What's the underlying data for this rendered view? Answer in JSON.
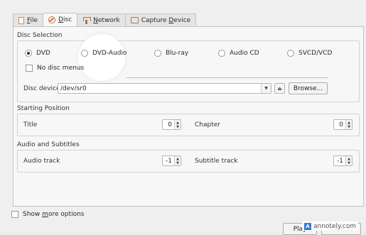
{
  "tabs": [
    {
      "prefix": "",
      "key": "F",
      "rest": "ile",
      "icon": "file-icon"
    },
    {
      "prefix": "",
      "key": "D",
      "rest": "isc",
      "icon": "disc-icon"
    },
    {
      "prefix": "",
      "key": "N",
      "rest": "etwork",
      "icon": "network-icon"
    },
    {
      "prefix": "Capture ",
      "key": "D",
      "rest": "evice",
      "icon": "capture-device-icon"
    }
  ],
  "disc_selection": {
    "title": "Disc Selection",
    "options": [
      "DVD",
      "DVD-Audio",
      "Blu-ray",
      "Audio CD",
      "SVCD/VCD"
    ],
    "selected": "DVD",
    "no_disc_menus": "No disc menus",
    "device_label": "Disc device",
    "device_value": "/dev/sr0",
    "eject_icon": "eject-icon",
    "browse_label": "Browse..."
  },
  "starting_position": {
    "title": "Starting Position",
    "title_label": "Title",
    "title_value": "0",
    "chapter_label": "Chapter",
    "chapter_value": "0"
  },
  "audio_subtitles": {
    "title": "Audio and Subtitles",
    "audio_label": "Audio track",
    "audio_value": "-1",
    "subtitle_label": "Subtitle track",
    "subtitle_value": "-1"
  },
  "footer": {
    "show_prefix": "Show ",
    "show_key": "m",
    "show_rest": "ore options",
    "play_label": "Play",
    "cancel_label": "Cancel"
  },
  "watermark": {
    "logo": "A",
    "text": "annotely.com"
  },
  "colors": {
    "accent_icon": "#d0703a",
    "watermark_logo": "#3a7bd5"
  }
}
